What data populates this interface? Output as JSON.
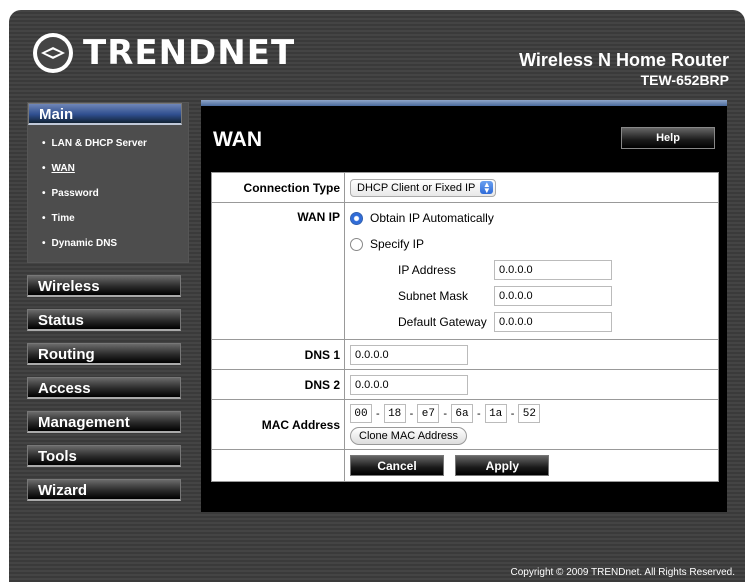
{
  "brand": {
    "name": "TRENDNET",
    "logo_icon": "trendnet-logo-icon"
  },
  "product": {
    "name": "Wireless N Home Router",
    "model": "TEW-652BRP"
  },
  "sidebar": {
    "main_label": "Main",
    "sub_items": [
      {
        "label": "LAN & DHCP Server"
      },
      {
        "label": "WAN"
      },
      {
        "label": "Password"
      },
      {
        "label": "Time"
      },
      {
        "label": "Dynamic DNS"
      }
    ],
    "menus": [
      {
        "label": "Wireless"
      },
      {
        "label": "Status"
      },
      {
        "label": "Routing"
      },
      {
        "label": "Access"
      },
      {
        "label": "Management"
      },
      {
        "label": "Tools"
      },
      {
        "label": "Wizard"
      }
    ]
  },
  "page": {
    "title": "WAN",
    "help_label": "Help"
  },
  "form": {
    "connection_type": {
      "label": "Connection Type",
      "value": "DHCP Client or Fixed IP"
    },
    "wan_ip": {
      "label": "WAN IP",
      "option_auto": "Obtain IP Automatically",
      "option_specify": "Specify IP",
      "ip_address_label": "IP Address",
      "ip_address": "0.0.0.0",
      "subnet_mask_label": "Subnet Mask",
      "subnet_mask": "0.0.0.0",
      "gateway_label": "Default Gateway",
      "gateway": "0.0.0.0"
    },
    "dns1": {
      "label": "DNS 1",
      "value": "0.0.0.0"
    },
    "dns2": {
      "label": "DNS 2",
      "value": "0.0.0.0"
    },
    "mac": {
      "label": "MAC Address",
      "octets": [
        "00",
        "18",
        "e7",
        "6a",
        "1a",
        "52"
      ],
      "separator": "-",
      "clone_label": "Clone MAC Address"
    },
    "cancel_label": "Cancel",
    "apply_label": "Apply"
  },
  "footer": {
    "copyright": "Copyright © 2009 TRENDnet. All Rights Reserved."
  },
  "colors": {
    "accent": "#2f4f8f",
    "panel_top": "#8fa6c9",
    "background": "#3f3f3f"
  }
}
